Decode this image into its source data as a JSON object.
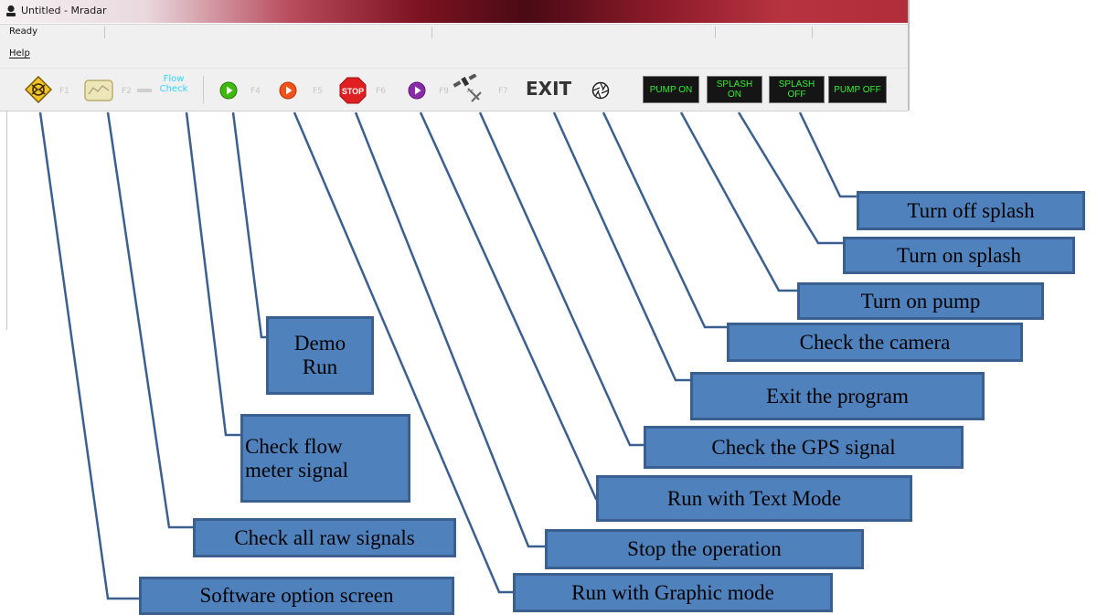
{
  "window": {
    "title": "Untitled - Mradar",
    "status": "Ready"
  },
  "menu": {
    "help": "Help"
  },
  "toolbar": {
    "fkeys": [
      "F1",
      "F2",
      "F4",
      "F5",
      "F6",
      "F9",
      "F7"
    ],
    "flow_check": "Flow\nCheck",
    "stop": "STOP",
    "exit": "EXIT",
    "pump_on": "PUMP ON",
    "splash_on": "SPLASH\nON",
    "splash_off": "SPLASH\nOFF",
    "pump_off": "PUMP OFF"
  },
  "callouts": {
    "software_option": "Software option screen",
    "raw_signals": "Check all raw signals",
    "flow_meter": "Check flow\nmeter signal",
    "demo_run": "Demo\nRun",
    "graphic_mode": "Run with Graphic mode",
    "stop_operation": "Stop the operation",
    "text_mode": "Run with Text Mode",
    "gps_signal": "Check the GPS signal",
    "exit_program": "Exit the program",
    "camera": "Check the camera",
    "pump_on": "Turn on pump",
    "splash_on": "Turn on splash",
    "splash_off": "Turn off splash"
  },
  "colors": {
    "callout_fill": "#4f81bd",
    "callout_border": "#3b5f8f",
    "leader_line": "#3b5f8f",
    "button_text_green": "#2ef02e",
    "flow_check_cyan": "#2fd4ff"
  }
}
